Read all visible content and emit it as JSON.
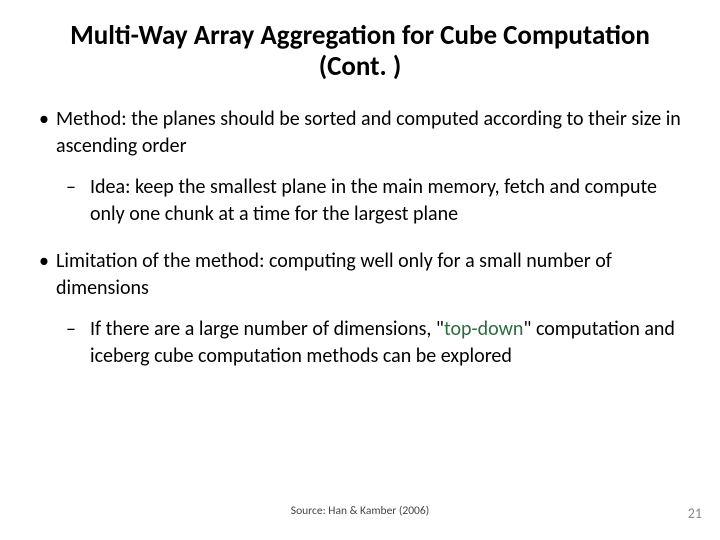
{
  "title": "Multi-Way Array Aggregation for Cube Computation (Cont. )",
  "bullets": {
    "b1": "Method: the planes should be sorted and computed according to their size in ascending order",
    "b1a": "Idea: keep the smallest plane in the main memory, fetch and compute only one chunk at a time for the largest plane",
    "b2": "Limitation of the method: computing well only for a small number of dimensions",
    "b2a_pre": "If there are a large number of dimensions, \"",
    "b2a_hl": "top-down",
    "b2a_post": "\" computation and iceberg cube computation methods can be explored"
  },
  "markers": {
    "dot": "•",
    "dash": "–"
  },
  "source": "Source: Han & Kamber (2006)",
  "page": "21"
}
